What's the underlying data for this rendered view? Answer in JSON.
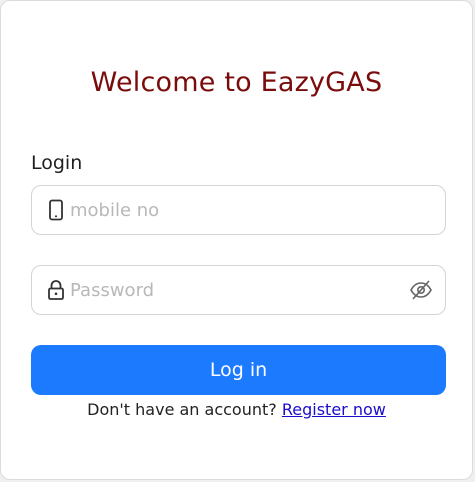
{
  "header": {
    "title": "Welcome to EazyGAS"
  },
  "form": {
    "section_label": "Login",
    "mobile": {
      "placeholder": "mobile no",
      "value": "",
      "icon": "mobile-phone-icon"
    },
    "password": {
      "placeholder": "Password",
      "value": "",
      "icon": "lock-icon",
      "toggle_icon": "eye-slash-icon"
    },
    "submit_label": "Log in"
  },
  "footer": {
    "prompt": "Don't have an account?",
    "link_label": "Register now"
  },
  "colors": {
    "title": "#7a0c0c",
    "button": "#1c7aff",
    "link": "#1a0dcc"
  }
}
